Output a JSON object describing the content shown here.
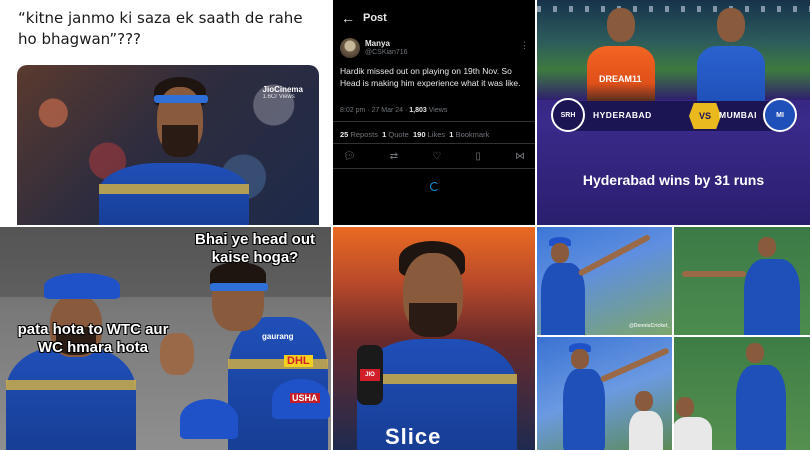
{
  "panel1": {
    "caption": "“kitne janmo ki saza ek saath de rahe ho bhagwan”???",
    "watermark": "JioCinema",
    "watermark_sub": "1.6Cr Views"
  },
  "panel2": {
    "header_title": "Post",
    "user_name": "Manya",
    "user_handle": "@CSKian716",
    "body": "Hardik missed out on playing on 19th Nov. So Head is making him experience what it was like.",
    "timestamp": "8:02 pm · 27 Mar 24 ·",
    "views_count": "1,803",
    "views_label": "Views",
    "reposts_count": "25",
    "reposts_label": "Reposts",
    "quotes_count": "1",
    "quotes_label": "Quote",
    "likes_count": "190",
    "likes_label": "Likes",
    "bookmarks_count": "1",
    "bookmarks_label": "Bookmark",
    "accent": "#1d9bf0"
  },
  "panel3": {
    "home_team": "HYDERABAD",
    "away_team": "MUMBAI",
    "vs_label": "VS",
    "result": "Hyderabad wins by 31 runs",
    "home_logo": "SRH",
    "away_logo": "MI",
    "home_sponsor": "DREAM11",
    "bar_color": "#1c1554",
    "vs_color": "#e9b91e"
  },
  "panel4": {
    "top_text": "Bhai ye head out kaise hoga?",
    "bottom_text": "pata hota to WTC aur WC hmara hota",
    "sponsor_a": "gaurang",
    "sponsor_b": "DHL",
    "sponsor_c": "USHA"
  },
  "panel5": {
    "sponsor_chest": "Slice",
    "mic_tag": "JIO"
  },
  "panel6": {
    "watermark": "@DennisCricket_"
  }
}
